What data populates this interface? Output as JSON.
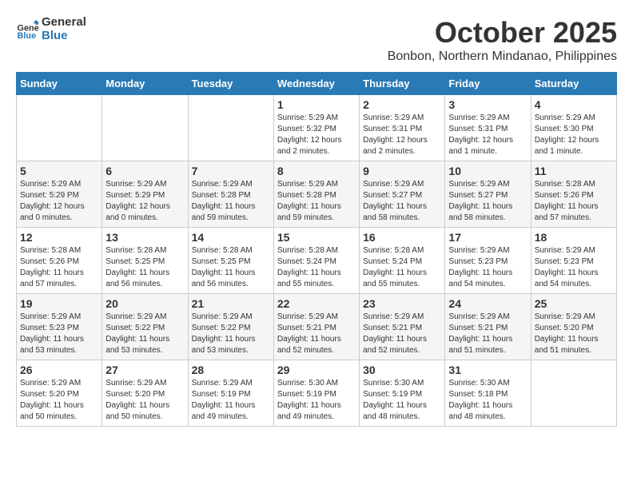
{
  "logo": {
    "line1": "General",
    "line2": "Blue"
  },
  "title": "October 2025",
  "subtitle": "Bonbon, Northern Mindanao, Philippines",
  "weekdays": [
    "Sunday",
    "Monday",
    "Tuesday",
    "Wednesday",
    "Thursday",
    "Friday",
    "Saturday"
  ],
  "weeks": [
    [
      {
        "day": "",
        "info": ""
      },
      {
        "day": "",
        "info": ""
      },
      {
        "day": "",
        "info": ""
      },
      {
        "day": "1",
        "info": "Sunrise: 5:29 AM\nSunset: 5:32 PM\nDaylight: 12 hours\nand 2 minutes."
      },
      {
        "day": "2",
        "info": "Sunrise: 5:29 AM\nSunset: 5:31 PM\nDaylight: 12 hours\nand 2 minutes."
      },
      {
        "day": "3",
        "info": "Sunrise: 5:29 AM\nSunset: 5:31 PM\nDaylight: 12 hours\nand 1 minute."
      },
      {
        "day": "4",
        "info": "Sunrise: 5:29 AM\nSunset: 5:30 PM\nDaylight: 12 hours\nand 1 minute."
      }
    ],
    [
      {
        "day": "5",
        "info": "Sunrise: 5:29 AM\nSunset: 5:29 PM\nDaylight: 12 hours\nand 0 minutes."
      },
      {
        "day": "6",
        "info": "Sunrise: 5:29 AM\nSunset: 5:29 PM\nDaylight: 12 hours\nand 0 minutes."
      },
      {
        "day": "7",
        "info": "Sunrise: 5:29 AM\nSunset: 5:28 PM\nDaylight: 11 hours\nand 59 minutes."
      },
      {
        "day": "8",
        "info": "Sunrise: 5:29 AM\nSunset: 5:28 PM\nDaylight: 11 hours\nand 59 minutes."
      },
      {
        "day": "9",
        "info": "Sunrise: 5:29 AM\nSunset: 5:27 PM\nDaylight: 11 hours\nand 58 minutes."
      },
      {
        "day": "10",
        "info": "Sunrise: 5:29 AM\nSunset: 5:27 PM\nDaylight: 11 hours\nand 58 minutes."
      },
      {
        "day": "11",
        "info": "Sunrise: 5:28 AM\nSunset: 5:26 PM\nDaylight: 11 hours\nand 57 minutes."
      }
    ],
    [
      {
        "day": "12",
        "info": "Sunrise: 5:28 AM\nSunset: 5:26 PM\nDaylight: 11 hours\nand 57 minutes."
      },
      {
        "day": "13",
        "info": "Sunrise: 5:28 AM\nSunset: 5:25 PM\nDaylight: 11 hours\nand 56 minutes."
      },
      {
        "day": "14",
        "info": "Sunrise: 5:28 AM\nSunset: 5:25 PM\nDaylight: 11 hours\nand 56 minutes."
      },
      {
        "day": "15",
        "info": "Sunrise: 5:28 AM\nSunset: 5:24 PM\nDaylight: 11 hours\nand 55 minutes."
      },
      {
        "day": "16",
        "info": "Sunrise: 5:28 AM\nSunset: 5:24 PM\nDaylight: 11 hours\nand 55 minutes."
      },
      {
        "day": "17",
        "info": "Sunrise: 5:29 AM\nSunset: 5:23 PM\nDaylight: 11 hours\nand 54 minutes."
      },
      {
        "day": "18",
        "info": "Sunrise: 5:29 AM\nSunset: 5:23 PM\nDaylight: 11 hours\nand 54 minutes."
      }
    ],
    [
      {
        "day": "19",
        "info": "Sunrise: 5:29 AM\nSunset: 5:23 PM\nDaylight: 11 hours\nand 53 minutes."
      },
      {
        "day": "20",
        "info": "Sunrise: 5:29 AM\nSunset: 5:22 PM\nDaylight: 11 hours\nand 53 minutes."
      },
      {
        "day": "21",
        "info": "Sunrise: 5:29 AM\nSunset: 5:22 PM\nDaylight: 11 hours\nand 53 minutes."
      },
      {
        "day": "22",
        "info": "Sunrise: 5:29 AM\nSunset: 5:21 PM\nDaylight: 11 hours\nand 52 minutes."
      },
      {
        "day": "23",
        "info": "Sunrise: 5:29 AM\nSunset: 5:21 PM\nDaylight: 11 hours\nand 52 minutes."
      },
      {
        "day": "24",
        "info": "Sunrise: 5:29 AM\nSunset: 5:21 PM\nDaylight: 11 hours\nand 51 minutes."
      },
      {
        "day": "25",
        "info": "Sunrise: 5:29 AM\nSunset: 5:20 PM\nDaylight: 11 hours\nand 51 minutes."
      }
    ],
    [
      {
        "day": "26",
        "info": "Sunrise: 5:29 AM\nSunset: 5:20 PM\nDaylight: 11 hours\nand 50 minutes."
      },
      {
        "day": "27",
        "info": "Sunrise: 5:29 AM\nSunset: 5:20 PM\nDaylight: 11 hours\nand 50 minutes."
      },
      {
        "day": "28",
        "info": "Sunrise: 5:29 AM\nSunset: 5:19 PM\nDaylight: 11 hours\nand 49 minutes."
      },
      {
        "day": "29",
        "info": "Sunrise: 5:30 AM\nSunset: 5:19 PM\nDaylight: 11 hours\nand 49 minutes."
      },
      {
        "day": "30",
        "info": "Sunrise: 5:30 AM\nSunset: 5:19 PM\nDaylight: 11 hours\nand 48 minutes."
      },
      {
        "day": "31",
        "info": "Sunrise: 5:30 AM\nSunset: 5:18 PM\nDaylight: 11 hours\nand 48 minutes."
      },
      {
        "day": "",
        "info": ""
      }
    ]
  ]
}
